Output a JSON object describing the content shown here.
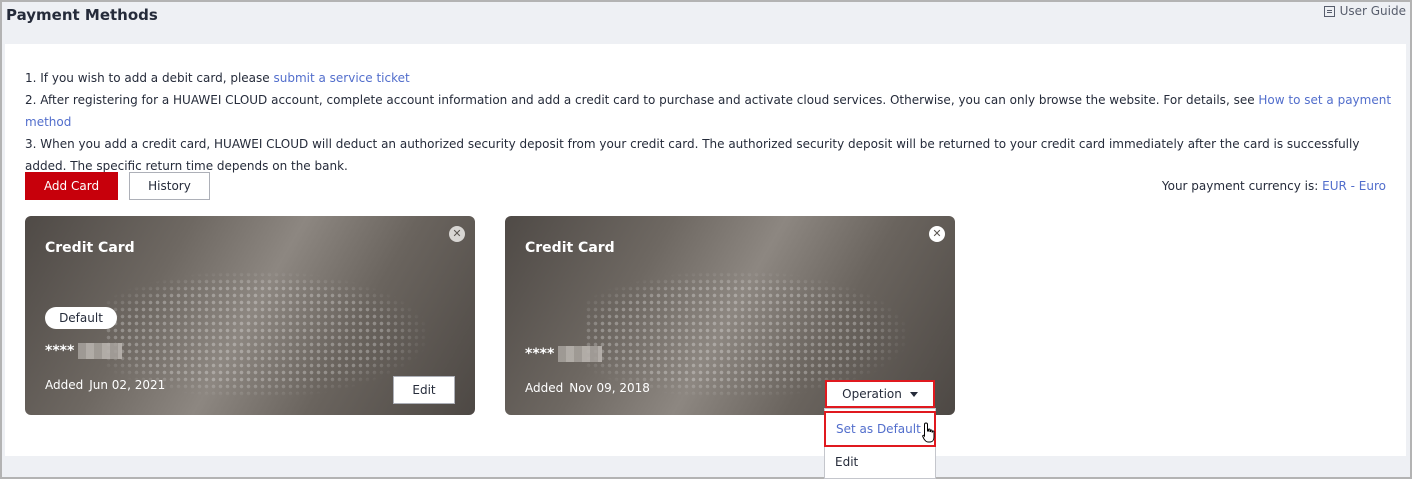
{
  "header": {
    "title": "Payment Methods",
    "user_guide": "User Guide",
    "user_guide_icon": "guide-icon"
  },
  "notes": {
    "line1_text": "1. If you wish to add a debit card, please ",
    "line1_link": "submit a service ticket",
    "line2_text": "2. After registering for a HUAWEI CLOUD account, complete account information and add a credit card to purchase and activate cloud services. Otherwise, you can only browse the website. For details, see ",
    "line2_link": "How to set a payment method",
    "line3_text": "3. When you add a credit card, HUAWEI CLOUD will deduct an authorized security deposit from your credit card. The authorized security deposit will be returned to your credit card immediately after the card is successfully added. The specific return time depends on the bank."
  },
  "toolbar": {
    "add_card_label": "Add Card",
    "history_label": "History",
    "currency_prefix": "Your payment currency is: ",
    "currency_value": "EUR - Euro"
  },
  "cards": [
    {
      "title": "Credit Card",
      "badge": "Default",
      "number_prefix": "****",
      "added_label": "Added",
      "added_date": "Jun 02, 2021",
      "edit_label": "Edit"
    },
    {
      "title": "Credit Card",
      "number_prefix": "****",
      "added_label": "Added",
      "added_date": "Nov 09, 2018"
    }
  ],
  "operation": {
    "label": "Operation",
    "menu": [
      "Set as Default",
      "Edit"
    ]
  },
  "colors": {
    "primary": "#c7000b",
    "link": "#526ecc",
    "highlight": "#e0191f"
  }
}
